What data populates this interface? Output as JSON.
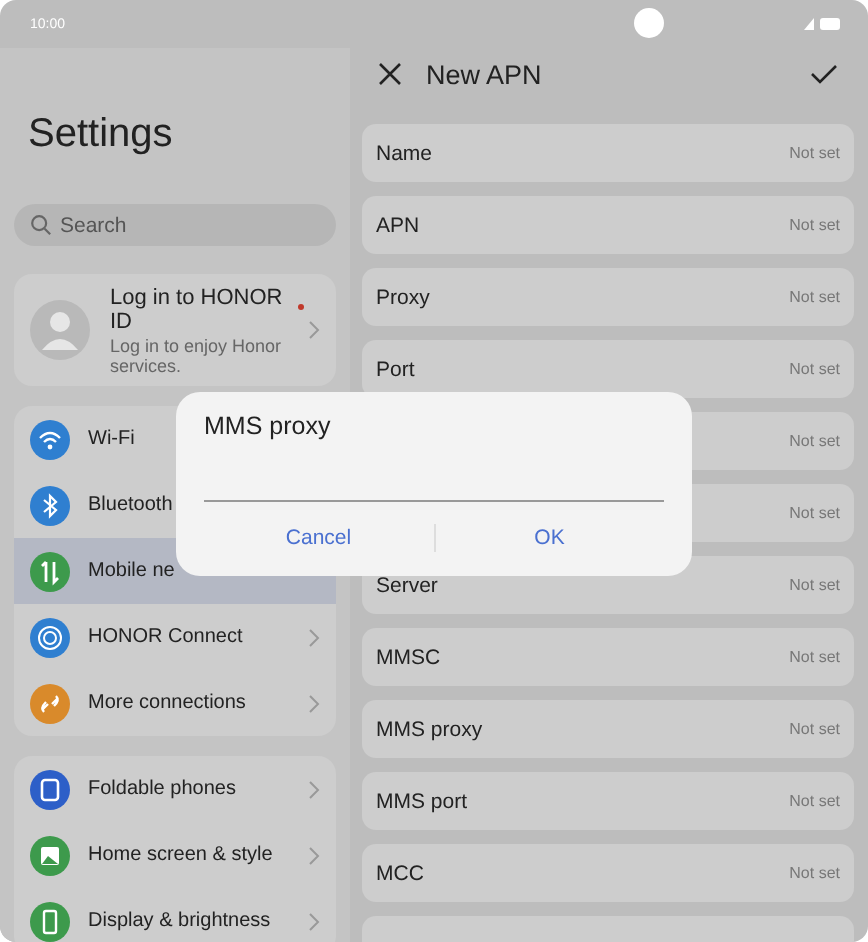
{
  "status_bar": {
    "time": "10:00"
  },
  "settings": {
    "title": "Settings",
    "search": {
      "placeholder": "Search"
    },
    "account": {
      "title": "Log in to HONOR ID",
      "subtitle": "Log in to enjoy Honor services.",
      "badge": true
    },
    "groups": [
      {
        "items": [
          {
            "label": "Wi-Fi",
            "kind": "wifi",
            "color": "#2f7fd0",
            "chevron": false,
            "selected": false
          },
          {
            "label": "Bluetooth",
            "kind": "bluetooth",
            "color": "#2f7fd0",
            "chevron": false,
            "selected": false
          },
          {
            "label": "Mobile ne",
            "kind": "mobile",
            "color": "#3d9a4c",
            "chevron": false,
            "selected": true
          },
          {
            "label": "HONOR Connect",
            "kind": "rings",
            "color": "#2f7fd0",
            "chevron": true,
            "selected": false
          },
          {
            "label": "More connections",
            "kind": "link",
            "color": "#d98a2b",
            "chevron": true,
            "selected": false
          }
        ]
      },
      {
        "items": [
          {
            "label": "Foldable phones",
            "kind": "fold",
            "color": "#2d5fc8",
            "chevron": true,
            "selected": false
          },
          {
            "label": "Home screen & style",
            "kind": "image",
            "color": "#3d9a4c",
            "chevron": true,
            "selected": false
          },
          {
            "label": "Display & brightness",
            "kind": "phone",
            "color": "#3d9a4c",
            "chevron": true,
            "selected": false
          }
        ]
      }
    ]
  },
  "apn": {
    "title": "New APN",
    "rows": [
      {
        "label": "Name",
        "value": "Not set"
      },
      {
        "label": "APN",
        "value": "Not set"
      },
      {
        "label": "Proxy",
        "value": "Not set"
      },
      {
        "label": "Port",
        "value": "Not set"
      },
      {
        "value": "Not set"
      },
      {
        "value": "Not set"
      },
      {
        "label": "Server",
        "value": "Not set"
      },
      {
        "label": "MMSC",
        "value": "Not set"
      },
      {
        "label": "MMS proxy",
        "value": "Not set"
      },
      {
        "label": "MMS port",
        "value": "Not set"
      },
      {
        "label": "MCC",
        "value": "Not set"
      }
    ]
  },
  "dialog": {
    "title": "MMS proxy",
    "buttons": [
      "Cancel",
      "OK"
    ]
  }
}
